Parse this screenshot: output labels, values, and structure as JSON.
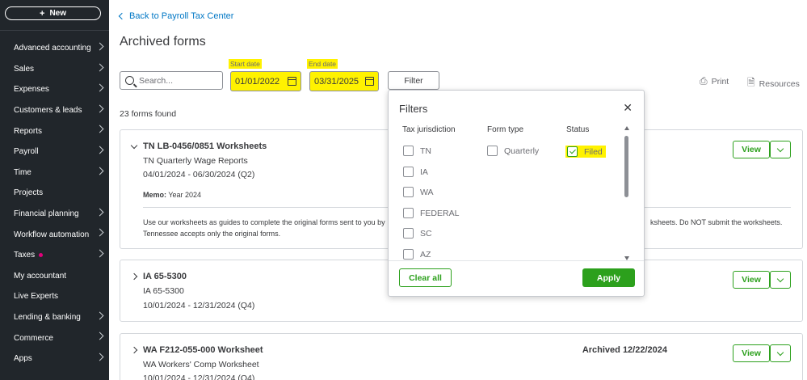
{
  "sidebar": {
    "new_label": "New",
    "items": [
      {
        "label": "Advanced accounting",
        "chevron": true
      },
      {
        "label": "Sales",
        "chevron": true
      },
      {
        "label": "Expenses",
        "chevron": true
      },
      {
        "label": "Customers & leads",
        "chevron": true
      },
      {
        "label": "Reports",
        "chevron": true
      },
      {
        "label": "Payroll",
        "chevron": true
      },
      {
        "label": "Time",
        "chevron": true
      },
      {
        "label": "Projects",
        "chevron": false
      },
      {
        "label": "Financial planning",
        "chevron": true
      },
      {
        "label": "Workflow automation",
        "chevron": true
      },
      {
        "label": "Taxes",
        "chevron": true,
        "dot": true
      },
      {
        "label": "My accountant",
        "chevron": false
      },
      {
        "label": "Live Experts",
        "chevron": false
      },
      {
        "label": "Lending & banking",
        "chevron": true
      },
      {
        "label": "Commerce",
        "chevron": true
      },
      {
        "label": "Apps",
        "chevron": true
      }
    ]
  },
  "header": {
    "back_link": "Back to Payroll Tax Center",
    "title": "Archived forms"
  },
  "toolbar": {
    "search_placeholder": "Search...",
    "start_date_label": "Start date",
    "start_date_value": "01/01/2022",
    "end_date_label": "End date",
    "end_date_value": "03/31/2025",
    "filter_label": "Filter",
    "print_label": "Print",
    "resources_label": "Resources"
  },
  "results": {
    "count_text": "23 forms found"
  },
  "forms": [
    {
      "title": "TN LB-0456/0851 Worksheets",
      "subtitle": "TN Quarterly Wage Reports",
      "period": "04/01/2024 - 06/30/2024 (Q2)",
      "memo_label": "Memo:",
      "memo_value": "Year 2024",
      "note_left": "Use our worksheets as guides to complete the original forms sent to you by",
      "note_right": "ksheets. Do NOT submit the worksheets.",
      "note_line2": "Tennessee accepts only the original forms.",
      "view_label": "View"
    },
    {
      "title": "IA 65-5300",
      "subtitle": "IA 65-5300",
      "period": "10/01/2024 - 12/31/2024 (Q4)",
      "view_label": "View"
    },
    {
      "title": "WA F212-055-000 Worksheet",
      "subtitle": "WA Workers' Comp Worksheet",
      "period": "10/01/2024 - 12/31/2024 (Q4)",
      "archived": "Archived 12/22/2024",
      "view_label": "View"
    }
  ],
  "filters_popup": {
    "title": "Filters",
    "col_jurisdiction": "Tax jurisdiction",
    "col_form_type": "Form type",
    "col_status": "Status",
    "jurisdictions": [
      "TN",
      "IA",
      "WA",
      "FEDERAL",
      "SC",
      "AZ"
    ],
    "form_types": [
      "Quarterly"
    ],
    "statuses": [
      {
        "label": "Filed",
        "checked": true
      }
    ],
    "clear_label": "Clear all",
    "apply_label": "Apply"
  },
  "colors": {
    "accent_green": "#2ca01c",
    "link_blue": "#0077c5",
    "sidebar_bg": "#21262b",
    "highlight": "#fff200"
  }
}
